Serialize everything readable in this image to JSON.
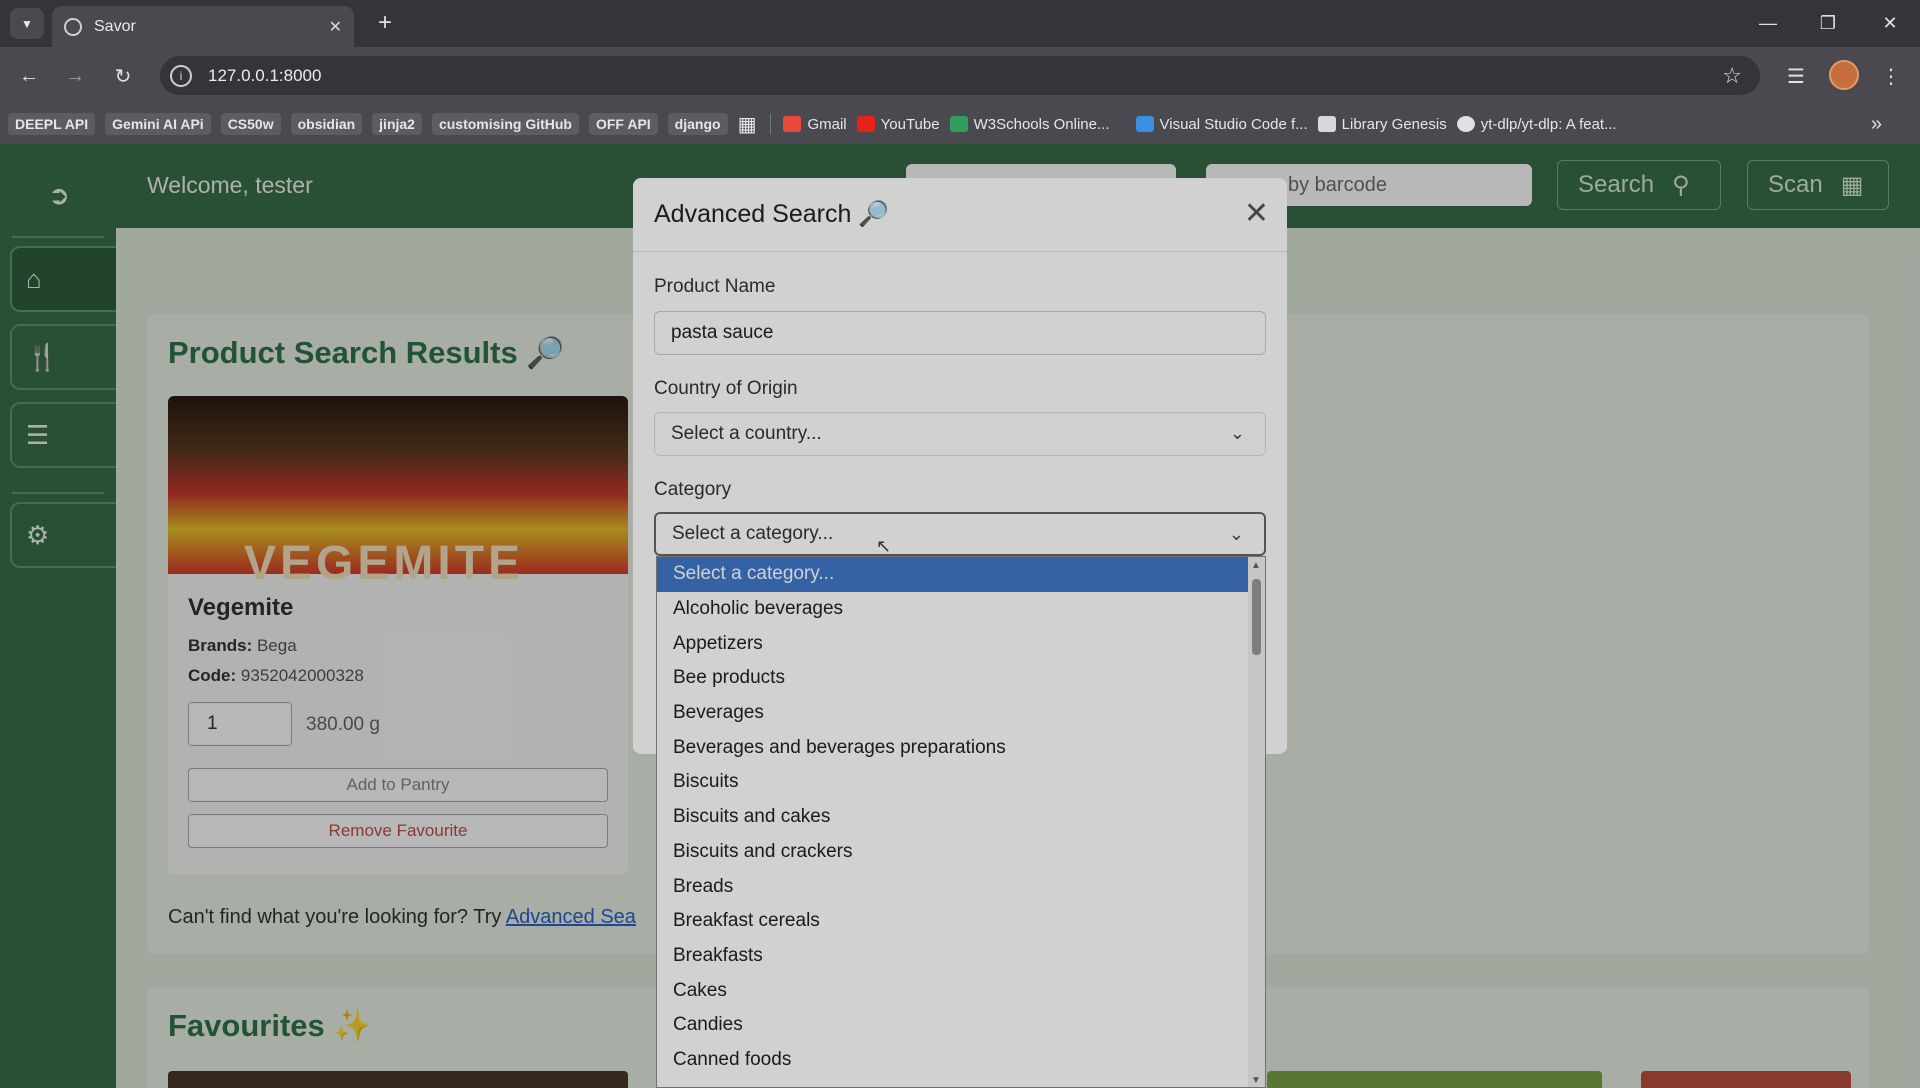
{
  "browser": {
    "tab_title": "Savor",
    "url": "127.0.0.1:8000",
    "bookmarks": [
      {
        "label": "DEEPL API",
        "chip": true
      },
      {
        "label": "Gemini AI APi",
        "chip": true
      },
      {
        "label": "CS50w",
        "chip": true
      },
      {
        "label": "obsidian",
        "chip": true
      },
      {
        "label": "jinja2",
        "chip": true
      },
      {
        "label": "customising GitHub",
        "chip": true
      },
      {
        "label": "OFF API",
        "chip": true
      },
      {
        "label": "django",
        "chip": true
      }
    ],
    "bookmarks_icons": [
      {
        "label": "Gmail",
        "color": "#e94a3b"
      },
      {
        "label": "YouTube",
        "color": "#e62117"
      },
      {
        "label": "W3Schools Online...",
        "color": "#2f9e5b"
      },
      {
        "label": "Visual Studio Code f...",
        "color": "#3b8fe0"
      },
      {
        "label": "Library Genesis",
        "color": "#d8d8dc"
      },
      {
        "label": "yt-dlp/yt-dlp: A feat...",
        "color": "#e0e0e4"
      }
    ]
  },
  "app": {
    "welcome": "Welcome, tester",
    "barcode_placeholder": "by barcode",
    "search_label": "Search",
    "scan_label": "Scan"
  },
  "results": {
    "title": "Product Search Results",
    "product": {
      "image_text": "VEGEMITE",
      "name": "Vegemite",
      "brands_label": "Brands:",
      "brands": "Bega",
      "code_label": "Code:",
      "code": "9352042000328",
      "quantity": "1",
      "unit": "380.00 g",
      "add_label": "Add to Pantry",
      "remove_label": "Remove Favourite"
    },
    "footer_text": "Can't find what you're looking for? Try ",
    "footer_link": "Advanced Sea"
  },
  "favourites": {
    "title": "Favourites"
  },
  "modal": {
    "title": "Advanced Search",
    "product_name_label": "Product Name",
    "product_name_value": "pasta sauce",
    "country_label": "Country of Origin",
    "country_value": "Select a country...",
    "category_label": "Category",
    "category_value": "Select a category..."
  },
  "dropdown": {
    "options": [
      "Select a category...",
      "Alcoholic beverages",
      "Appetizers",
      "Bee products",
      "Beverages",
      "Beverages and beverages preparations",
      "Biscuits",
      "Biscuits and cakes",
      "Biscuits and crackers",
      "Breads",
      "Breakfast cereals",
      "Breakfasts",
      "Cakes",
      "Candies",
      "Canned foods"
    ],
    "selected_index": 0
  },
  "colors": {
    "sidebar_green": "#3a6e4a",
    "title_green": "#2f7448",
    "selection_blue": "#3f78c9"
  }
}
